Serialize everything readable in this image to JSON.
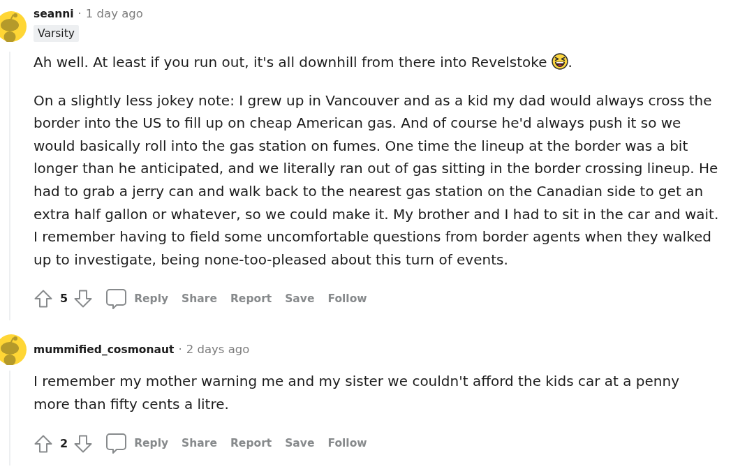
{
  "comments": [
    {
      "author": "seanni",
      "separator": "·",
      "time": "1 day ago",
      "flair": "Varsity",
      "paragraphs": [
        [
          {
            "kind": "text",
            "text": "Ah well. At least if you run out, it's all downhill from there into Revelstoke"
          },
          {
            "kind": "emoji"
          },
          {
            "kind": "text",
            "text": "."
          }
        ],
        [
          {
            "kind": "text",
            "text": "On a slightly less jokey note: I grew up in Vancouver and as a kid my dad would always cross the border into the US to fill up on cheap American gas. And of course he'd always push it so we would basically roll into the gas station on fumes. One time the lineup at the border was a bit longer than he anticipated, and we literally ran out of gas sitting in the border crossing lineup. He had to grab a jerry can and walk back to the nearest gas station on the Canadian side to get an extra half gallon or whatever, so we could make it. My brother and I had to sit in the car and wait. I remember having to field some uncomfortable questions from border agents when they walked up to investigate, being none-too-pleased about this turn of events."
          }
        ]
      ],
      "score": "5",
      "actions": [
        {
          "kind": "reply",
          "label": "Reply"
        },
        {
          "kind": "share",
          "label": "Share"
        },
        {
          "kind": "report",
          "label": "Report"
        },
        {
          "kind": "save",
          "label": "Save"
        },
        {
          "kind": "follow",
          "label": "Follow"
        }
      ]
    },
    {
      "author": "mummified_cosmonaut",
      "separator": "·",
      "time": "2 days ago",
      "paragraphs": [
        [
          {
            "kind": "text",
            "text": "I remember my mother warning me and my sister we couldn't afford the kids car at a penny more than fifty cents a litre."
          }
        ]
      ],
      "score": "2",
      "actions": [
        {
          "kind": "reply",
          "label": "Reply"
        },
        {
          "kind": "share",
          "label": "Share"
        },
        {
          "kind": "report",
          "label": "Report"
        },
        {
          "kind": "save",
          "label": "Save"
        },
        {
          "kind": "follow",
          "label": "Follow"
        }
      ]
    }
  ]
}
